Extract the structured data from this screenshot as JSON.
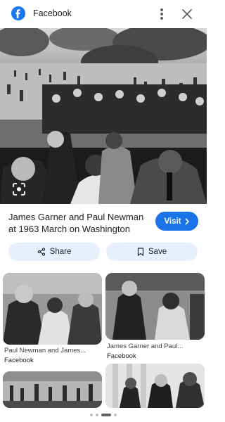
{
  "header": {
    "site_name": "Facebook",
    "logo_letter": "f",
    "brand_color": "#1877f2",
    "icons": [
      "facebook-logo-icon",
      "more-vert-icon",
      "close-icon"
    ]
  },
  "result": {
    "title": "James Garner and Paul Newman at 1963 March on Washington",
    "visit_label": "Visit",
    "visit_icon": "chevron-right-icon",
    "accent_color": "#1a73e8"
  },
  "actions": {
    "share_label": "Share",
    "share_icon": "share-icon",
    "save_label": "Save",
    "save_icon": "bookmark-icon"
  },
  "related": [
    {
      "caption": "Paul Newman and James...",
      "source": "Facebook"
    },
    {
      "caption": "James Garner and Paul...",
      "source": "Facebook"
    },
    {
      "caption": "",
      "source": ""
    },
    {
      "caption": "",
      "source": ""
    }
  ]
}
